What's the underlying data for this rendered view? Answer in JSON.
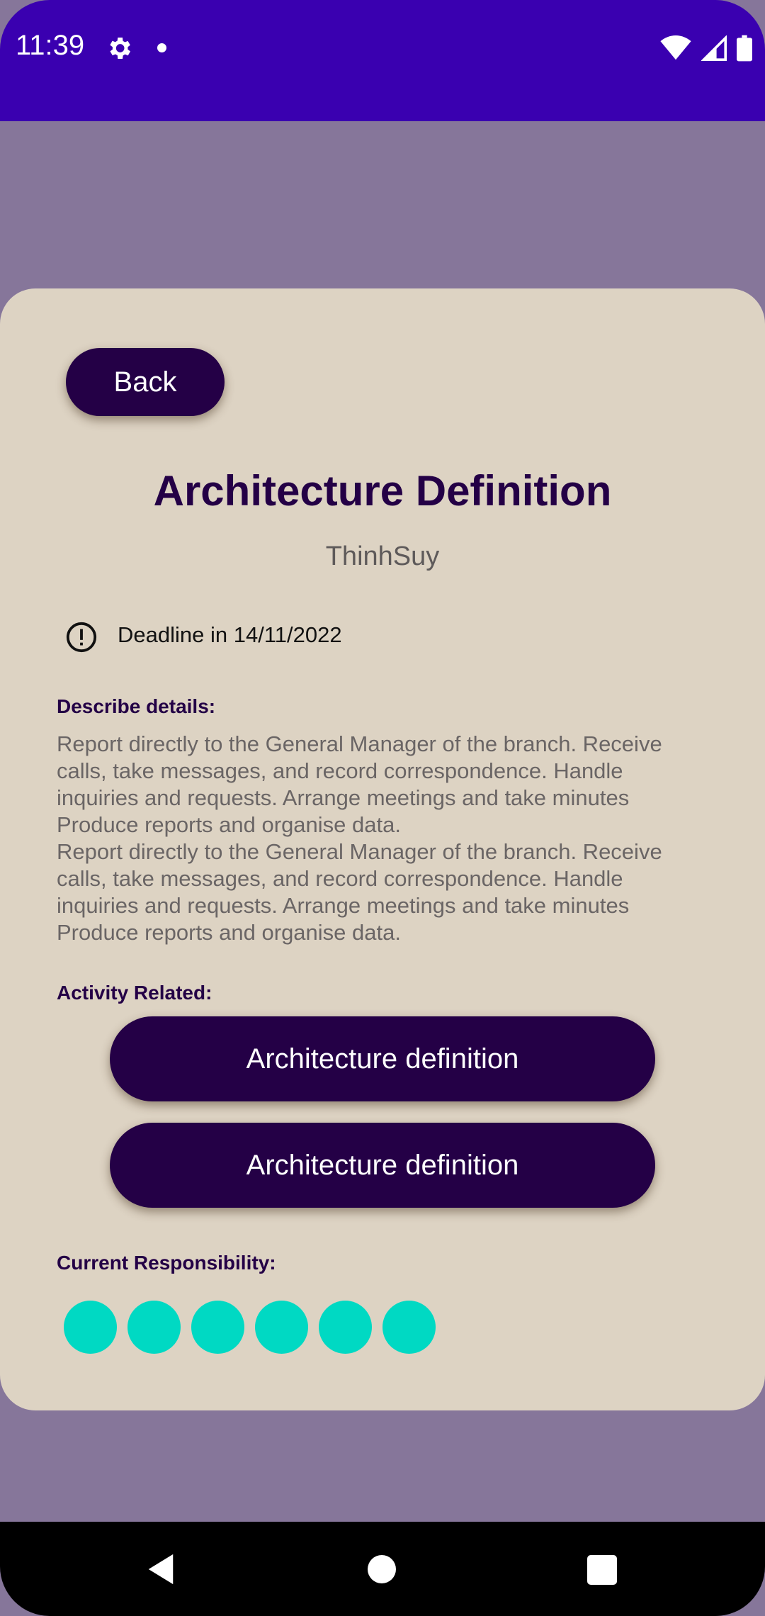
{
  "status_bar": {
    "time": "11:39",
    "icons": [
      "gear-icon",
      "notification-dot-icon",
      "wifi-icon",
      "cellular-signal-icon",
      "battery-icon"
    ],
    "background": "#3a00b0"
  },
  "detail": {
    "back_label": "Back",
    "title": "Architecture Definition",
    "author": "ThinhSuy",
    "deadline_icon": "alert-circle-icon",
    "deadline": "Deadline in 14/11/2022",
    "describe_label": "Describe details:",
    "description": "Report directly to the General Manager of the branch. Receive calls, take messages, and record correspondence. Handle inquiries and requests. Arrange meetings and take minutes Produce reports and organise data.\nReport directly to the General Manager of the branch. Receive calls, take messages, and record correspondence. Handle inquiries and requests. Arrange meetings and take minutes Produce reports and organise data.",
    "activity_label": "Activity Related:",
    "activities": [
      {
        "label": "Architecture definition"
      },
      {
        "label": "Architecture definition"
      }
    ],
    "responsibility_label": "Current Responsibility:",
    "responsible_count": 6
  },
  "nav_bar": {
    "icons": [
      "back-triangle-icon",
      "home-circle-icon",
      "recents-square-icon"
    ]
  },
  "colors": {
    "primary_dark": "#240046",
    "card_bg": "#ddd3c3",
    "backdrop": "#86769a",
    "avatar": "#00d9c3"
  }
}
